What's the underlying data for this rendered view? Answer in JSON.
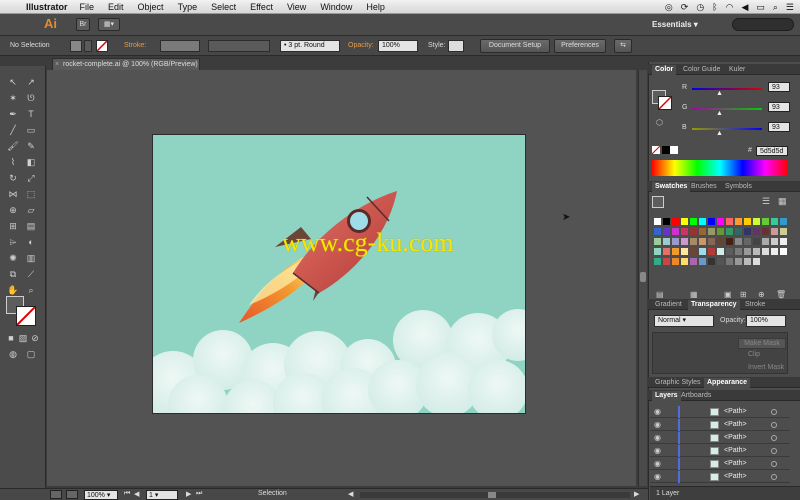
{
  "menubar": {
    "app_name": "Illustrator",
    "menus": [
      "File",
      "Edit",
      "Object",
      "Type",
      "Select",
      "Effect",
      "View",
      "Window",
      "Help"
    ]
  },
  "appbar": {
    "logo": "Ai",
    "bridge_label": "Br",
    "workspace": "Essentials"
  },
  "control": {
    "selection": "No Selection",
    "stroke_label": "Stroke:",
    "brush": "3 pt. Round",
    "opacity_label": "Opacity:",
    "opacity_value": "100%",
    "style_label": "Style:",
    "document_setup": "Document Setup",
    "preferences": "Preferences"
  },
  "document": {
    "tab_title": "rocket-complete.ai @ 100% (RGB/Preview)",
    "watermark": "www.cg-ku.com"
  },
  "status": {
    "zoom": "100%",
    "page": "1",
    "mode": "Selection"
  },
  "color_panel": {
    "tabs": [
      "Color",
      "Color Guide",
      "Kuler"
    ],
    "r_label": "R",
    "g_label": "G",
    "b_label": "B",
    "r_value": "93",
    "g_value": "93",
    "b_value": "93",
    "hex_label": "#",
    "hex_value": "5d5d5d"
  },
  "swatches_panel": {
    "tabs": [
      "Swatches",
      "Brushes",
      "Symbols"
    ]
  },
  "transparency_panel": {
    "tabs": [
      "Gradient",
      "Transparency",
      "Stroke"
    ],
    "blend_mode": "Normal",
    "opacity_label": "Opacity:",
    "opacity_value": "100%",
    "make_mask": "Make Mask",
    "clip": "Clip",
    "invert_mask": "Invert Mask"
  },
  "appearance_panel": {
    "tabs": [
      "Graphic Styles",
      "Appearance"
    ]
  },
  "layers_panel": {
    "tabs": [
      "Layers",
      "Artboards"
    ],
    "rows": [
      "<Path>",
      "<Path>",
      "<Path>",
      "<Path>",
      "<Path>",
      "<Path>"
    ],
    "footer": "1 Layer"
  },
  "colors": {
    "artboard_bg": "#8fd3c3",
    "accent_orange": "#e48a2c"
  }
}
